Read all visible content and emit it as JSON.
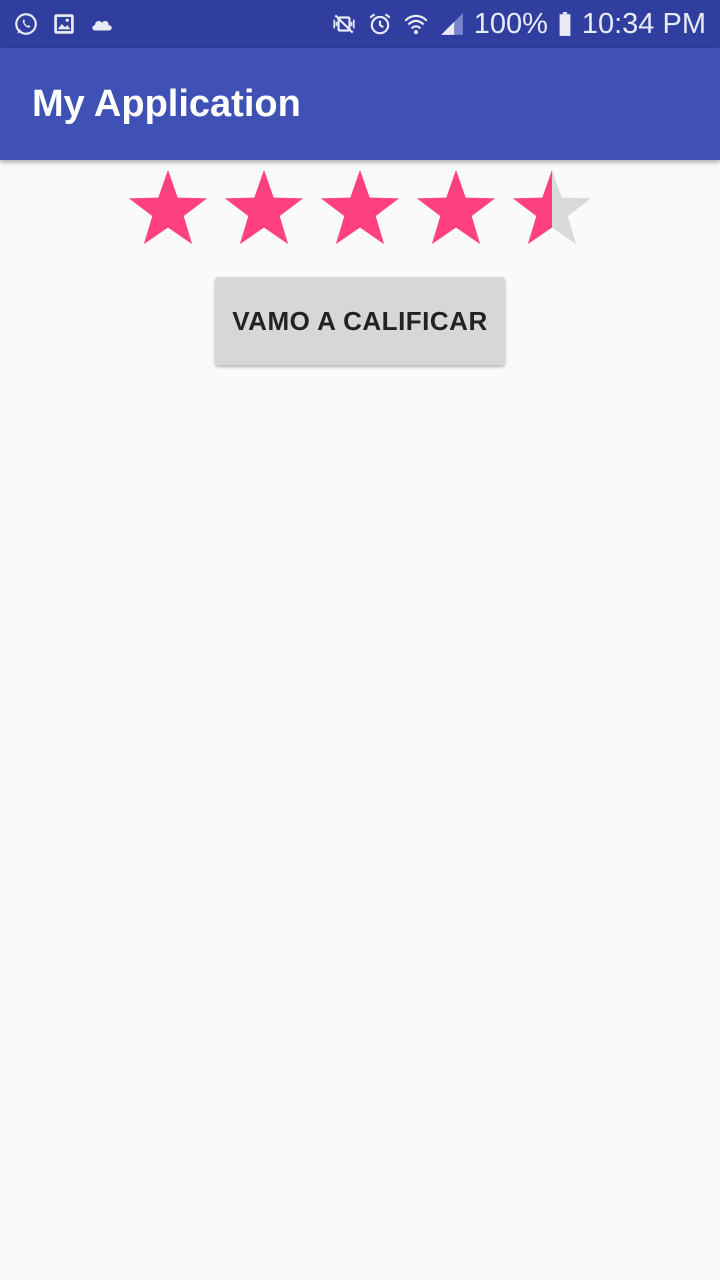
{
  "status_bar": {
    "battery": "100%",
    "time": "10:34 PM",
    "icons_left": [
      "whatsapp-icon",
      "image-icon",
      "cloud-icon"
    ],
    "icons_right": [
      "mute-vibrate-icon",
      "alarm-icon",
      "wifi-icon",
      "signal-icon",
      "battery-icon"
    ]
  },
  "app_bar": {
    "title": "My Application"
  },
  "rating": {
    "value": 4.5,
    "max": 5,
    "filled_color": "#ff4081",
    "empty_color": "#d9d9d9"
  },
  "button": {
    "label": "VAMO A CALIFICAR"
  },
  "colors": {
    "status_bar": "#303f9f",
    "app_bar": "#3f51b5",
    "background": "#fafafa"
  }
}
